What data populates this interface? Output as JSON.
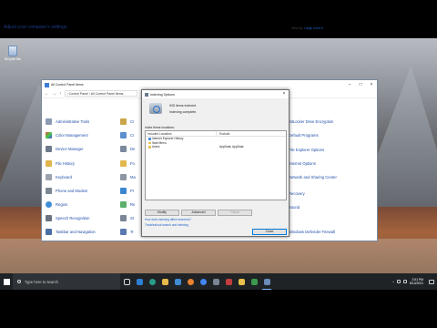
{
  "desktop": {
    "icon_label": "Recycle Bin"
  },
  "control_panel": {
    "title": "All Control Panel Items",
    "address": "› Control Panel › All Control Panel Items",
    "heading": "Adjust your computer's settings",
    "view_by_label": "View by:",
    "view_by_value": "Large icons ▾",
    "left_items": [
      "Administrative Tools",
      "Color Management",
      "Device Manager",
      "File History",
      "Keyboard",
      "Phone and Modem",
      "Region",
      "Speech Recognition",
      "Taskbar and Navigation"
    ],
    "mid_items": [
      "Cr",
      "Cr",
      "De",
      "Fo",
      "Ma",
      "Pr",
      "Re",
      "St",
      "Tr"
    ],
    "right_items": [
      "BitLocker Drive Encryption",
      "Default Programs",
      "File Explorer Options",
      "Internet Options",
      "Network and Sharing Center",
      "Recovery",
      "Sound",
      "Windows Defender Firewall"
    ],
    "colors": {
      "link": "#1f4fa8",
      "heading": "#1e3a8a"
    }
  },
  "dialog": {
    "title": "Indexing Options",
    "items_indexed": "925 items indexed",
    "status": "Indexing complete.",
    "list_label": "Index these locations:",
    "col_included": "Included Locations",
    "col_exclude": "Exclude",
    "locations": [
      {
        "name": "Internet Explorer History",
        "exclude": ""
      },
      {
        "name": "Start Menu",
        "exclude": ""
      },
      {
        "name": "Users",
        "exclude": "AppData; AppData"
      }
    ],
    "buttons": {
      "modify": "Modify",
      "advanced": "Advanced",
      "pause": "Pause",
      "close": "Close"
    },
    "link1": "How does indexing affect searches?",
    "link2": "Troubleshoot search and indexing"
  },
  "taskbar": {
    "search_placeholder": "Type here to search",
    "time": "2:51 PM",
    "date": "8/13/2021"
  }
}
